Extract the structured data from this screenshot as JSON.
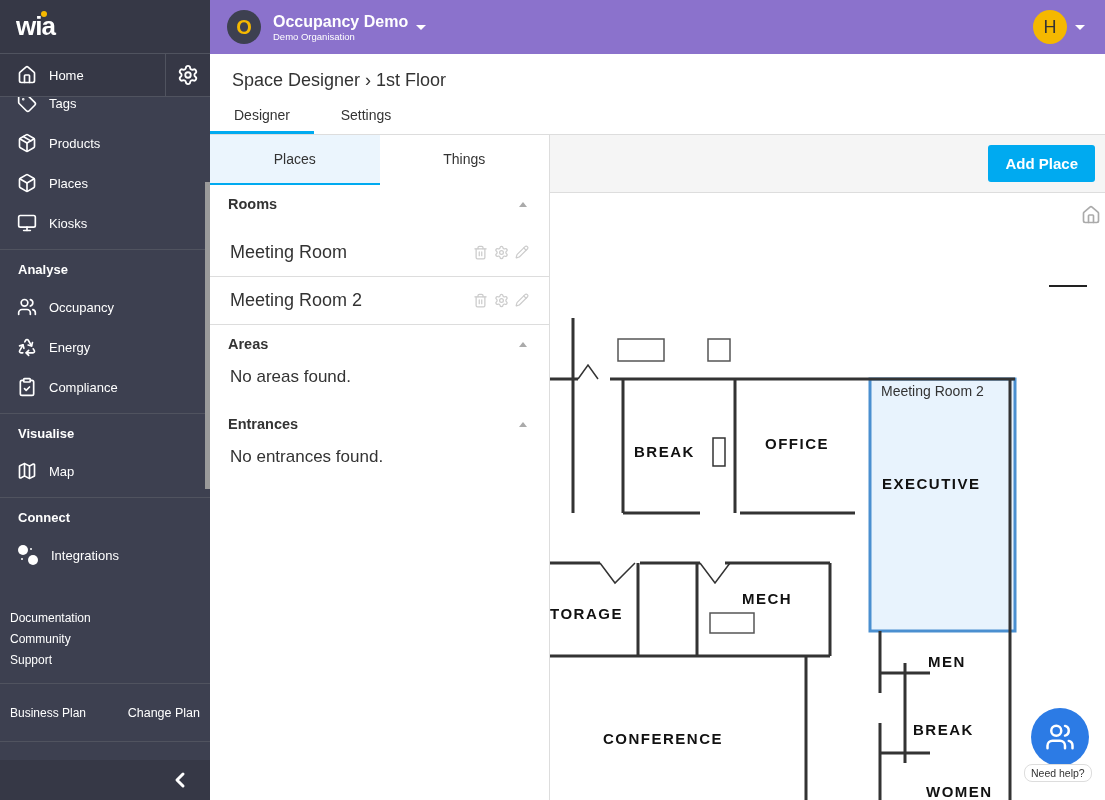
{
  "sidebar": {
    "logo": "wia",
    "home": "Home",
    "sections": [
      {
        "items": [
          {
            "label": "Tags"
          },
          {
            "label": "Products"
          },
          {
            "label": "Places"
          },
          {
            "label": "Kiosks"
          }
        ]
      },
      {
        "title": "Analyse",
        "items": [
          {
            "label": "Occupancy"
          },
          {
            "label": "Energy"
          },
          {
            "label": "Compliance"
          }
        ]
      },
      {
        "title": "Visualise",
        "items": [
          {
            "label": "Map"
          }
        ]
      },
      {
        "title": "Connect",
        "items": [
          {
            "label": "Integrations"
          }
        ]
      }
    ],
    "links": [
      "Documentation",
      "Community",
      "Support"
    ],
    "plan": {
      "name": "Business Plan",
      "action": "Change Plan"
    }
  },
  "topbar": {
    "avatar": "O",
    "title": "Occupancy Demo",
    "subtitle": "Demo Organisation",
    "user": "H"
  },
  "breadcrumb": "Space Designer › 1st Floor",
  "tabs": [
    {
      "label": "Designer",
      "selected": true
    },
    {
      "label": "Settings",
      "selected": false
    }
  ],
  "panel": {
    "tabs": [
      {
        "label": "Places",
        "selected": true
      },
      {
        "label": "Things",
        "selected": false
      }
    ],
    "sections": [
      {
        "title": "Rooms",
        "expanded": true,
        "items": [
          "Meeting Room",
          "Meeting Room 2"
        ]
      },
      {
        "title": "Areas",
        "expanded": true,
        "empty": "No areas found."
      },
      {
        "title": "Entrances",
        "expanded": true,
        "empty": "No entrances found."
      }
    ]
  },
  "canvas": {
    "button": "Add Place",
    "room_label": "Meeting Room 2",
    "plan_labels": [
      "BREAK",
      "OFFICE",
      "EXECUTIVE",
      "TORAGE",
      "MECH",
      "MEN",
      "CONFERENCE",
      "BREAK",
      "WOMEN"
    ],
    "help": "Need help?"
  }
}
